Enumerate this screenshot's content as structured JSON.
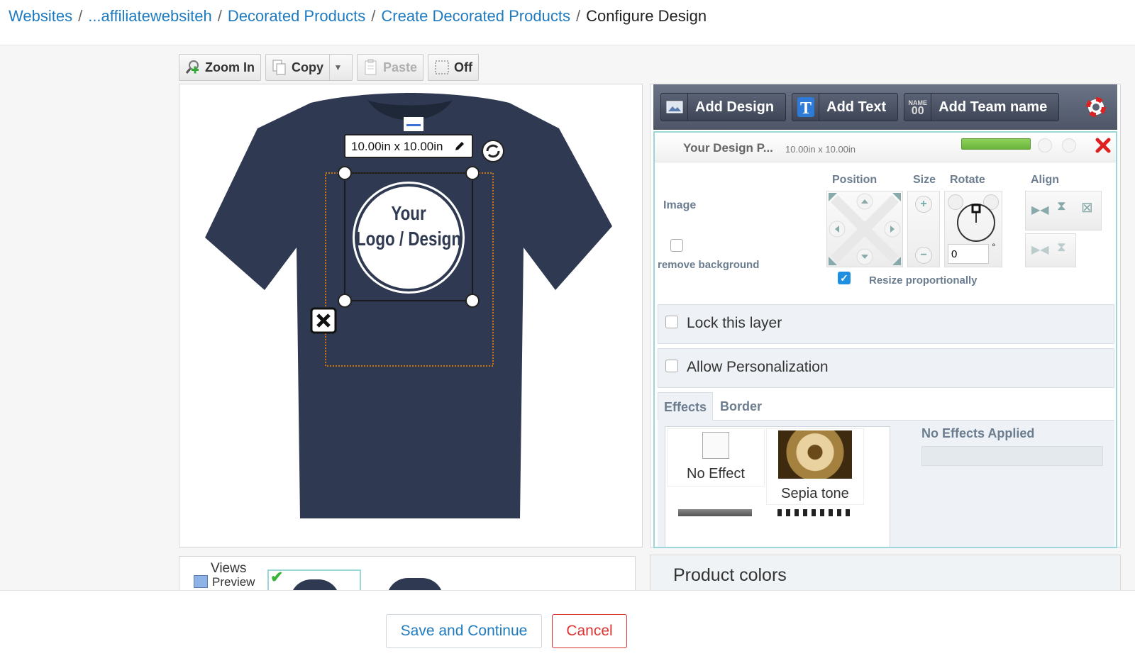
{
  "breadcrumb": {
    "items": [
      "Websites",
      "...affiliatewebsiteh",
      "Decorated Products",
      "Create Decorated Products"
    ],
    "current": "Configure Design",
    "separator": "/"
  },
  "toolbar": {
    "zoom_in": "Zoom In",
    "copy": "Copy",
    "paste": "Paste",
    "off": "Off"
  },
  "canvas": {
    "size_label": "10.00in x 10.00in",
    "logo_line1": "Your",
    "logo_line2": "Logo / Design",
    "shirt_color": "#2f3a52"
  },
  "designer": {
    "add_design": "Add Design",
    "add_text": "Add Text",
    "add_team_name": "Add Team name",
    "team_icon_top": "NAME",
    "team_icon_bottom": "00"
  },
  "layer": {
    "title": "Your Design P...",
    "dims": "10.00in x 10.00in",
    "image_label": "Image",
    "remove_bg": "remove background",
    "position": "Position",
    "size": "Size",
    "rotate": "Rotate",
    "align": "Align",
    "rotate_value": "0",
    "degree": "°",
    "resize_prop": "Resize proportionally",
    "lock": "Lock this layer",
    "personalize": "Allow Personalization",
    "tab_effects": "Effects",
    "tab_border": "Border",
    "no_effect": "No Effect",
    "sepia": "Sepia tone",
    "no_effects_applied": "No Effects Applied"
  },
  "views": {
    "line1": "Views",
    "line2": "Preview"
  },
  "product_colors": "Product colors",
  "footer": {
    "save": "Save and Continue",
    "cancel": "Cancel"
  },
  "colors": {
    "link": "#1f7bbf",
    "accent": "#9bd6d8",
    "danger": "#dd3333"
  }
}
